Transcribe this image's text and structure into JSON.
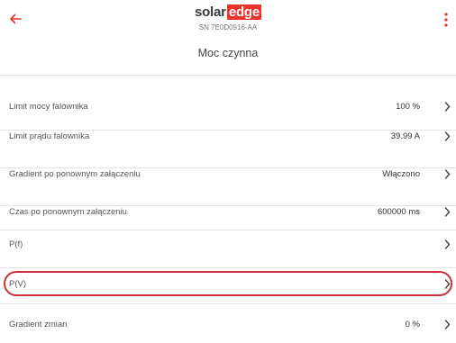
{
  "header": {
    "logo_part1": "solar",
    "logo_part2": "edge",
    "serial": "SN 7E0D0916-AA",
    "accent_color": "#e8322a"
  },
  "page_title": "Moc czynna",
  "rows": [
    {
      "label": "Limit mocy falownika",
      "value": "100 %"
    },
    {
      "label": "Limit prądu falownika",
      "value": "39.99 A"
    },
    {
      "label": "Gradient po ponownym załączeniu",
      "value": "Włączono"
    },
    {
      "label": "Czas po ponownym załączeniu",
      "value": "600000 ms"
    },
    {
      "label": "P(f)",
      "value": ""
    },
    {
      "label": "P(V)",
      "value": ""
    },
    {
      "label": "Gradient zmian",
      "value": "0 %"
    }
  ],
  "icons": {
    "back": "arrow-left-icon",
    "menu": "kebab-menu-icon",
    "row": "chevron-right-icon"
  },
  "highlight_color": "#c9303a"
}
